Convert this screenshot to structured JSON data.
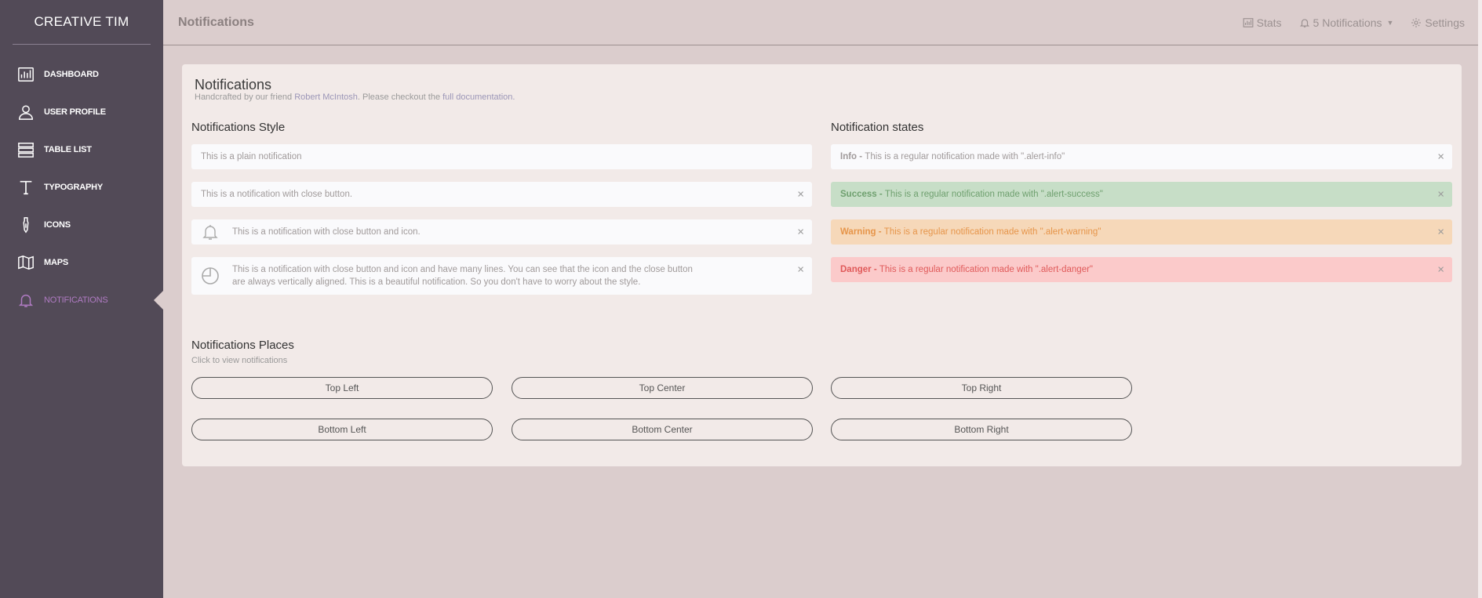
{
  "sidebar": {
    "brand": "CREATIVE TIM",
    "items": [
      {
        "label": "Dashboard",
        "icon": "chart-icon"
      },
      {
        "label": "User Profile",
        "icon": "user-icon"
      },
      {
        "label": "Table List",
        "icon": "table-icon"
      },
      {
        "label": "Typography",
        "icon": "text-icon"
      },
      {
        "label": "Icons",
        "icon": "pen-icon"
      },
      {
        "label": "Maps",
        "icon": "map-icon"
      },
      {
        "label": "Notifications",
        "icon": "bell-icon",
        "active": true
      }
    ]
  },
  "header": {
    "title": "Notifications",
    "stats": "Stats",
    "notifications": "5 Notifications",
    "settings": "Settings"
  },
  "card": {
    "title": "Notifications",
    "sub_prefix": "Handcrafted by our friend ",
    "author": "Robert McIntosh",
    "sub_middle": ". Please checkout the ",
    "doc_link": "full documentation.",
    "style_title": "Notifications Style",
    "states_title": "Notification states",
    "style_alerts": [
      "This is a plain notification",
      "This is a notification with close button.",
      "This is a notification with close button and icon.",
      "This is a notification with close button and icon and have many lines. You can see that the icon and the close button are always vertically aligned. This is a beautiful notification. So you don't have to worry about the style."
    ],
    "states": [
      {
        "label": "Info - ",
        "text": "This is a regular notification made with \".alert-info\""
      },
      {
        "label": "Success - ",
        "text": "This is a regular notification made with \".alert-success\""
      },
      {
        "label": "Warning - ",
        "text": "This is a regular notification made with \".alert-warning\""
      },
      {
        "label": "Danger - ",
        "text": "This is a regular notification made with \".alert-danger\""
      }
    ],
    "close": "×",
    "places_title": "Notifications Places",
    "places_sub": "Click to view notifications",
    "places": [
      "Top Left",
      "Top Center",
      "Top Right",
      "Bottom Left",
      "Bottom Center",
      "Bottom Right"
    ]
  },
  "colors": {
    "sidebar": "#524a57",
    "active": "#b07bc3",
    "background": "#dbcdcd",
    "success": "#c7dec7",
    "warning": "#f6d8b9",
    "danger": "#fbcaca"
  }
}
